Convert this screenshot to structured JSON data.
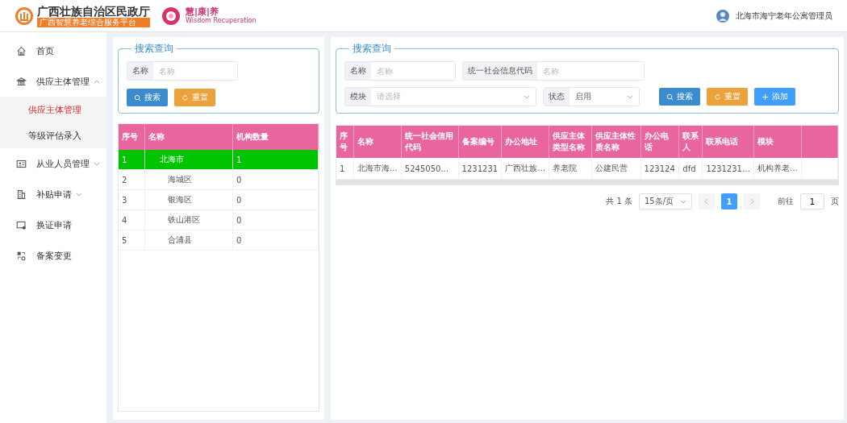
{
  "header": {
    "org_title": "广西壮族自治区民政厅",
    "org_subtitle": "广西智慧养老综合服务平台",
    "brand_title": "慧|康|养",
    "brand_subtitle": "Wisdom Recuperation",
    "user": "北海市海宁老年公寓管理员"
  },
  "sidebar": {
    "items": [
      {
        "label": "首页"
      },
      {
        "label": "供应主体管理",
        "expanded": true,
        "children": [
          {
            "label": "供应主体管理",
            "selected": true
          },
          {
            "label": "等级评估录入",
            "selected": false
          }
        ]
      },
      {
        "label": "从业人员管理",
        "expanded": false
      },
      {
        "label": "补贴申请",
        "expanded": false
      },
      {
        "label": "换证申请"
      },
      {
        "label": "备案变更"
      }
    ]
  },
  "left_panel": {
    "search": {
      "legend": "搜索查询",
      "fields": [
        {
          "label": "名称",
          "placeholder": "名称"
        }
      ],
      "buttons": [
        {
          "kind": "search",
          "label": "搜索"
        },
        {
          "kind": "reset",
          "label": "重置"
        }
      ]
    },
    "table": {
      "columns": [
        "序号",
        "名称",
        "机构数量"
      ],
      "rows": [
        {
          "index": "1",
          "name": "北海市",
          "count": "1",
          "selected": true,
          "expanded": true,
          "children": [
            {
              "index": "2",
              "name": "海城区",
              "count": "0",
              "selected": false
            },
            {
              "index": "3",
              "name": "银海区",
              "count": "0",
              "selected": false
            },
            {
              "index": "4",
              "name": "铁山港区",
              "count": "0",
              "selected": false
            },
            {
              "index": "5",
              "name": "合浦县",
              "count": "0",
              "selected": false
            }
          ]
        }
      ]
    }
  },
  "right_panel": {
    "search": {
      "legend": "搜索查询",
      "fields": [
        {
          "kind": "input",
          "label": "名称",
          "placeholder": "名称"
        },
        {
          "kind": "input",
          "label": "统一社会信息代码",
          "placeholder": "名称"
        },
        {
          "kind": "select",
          "label": "模块",
          "placeholder": "请选择"
        },
        {
          "kind": "select",
          "label": "状态",
          "value": "启用"
        }
      ],
      "buttons": [
        {
          "kind": "search",
          "label": "搜索"
        },
        {
          "kind": "reset",
          "label": "重置"
        },
        {
          "kind": "add",
          "label": "添加"
        }
      ]
    },
    "table": {
      "columns": [
        "序号",
        "名称",
        "统一社会信用代码",
        "备案编号",
        "办公地址",
        "供应主体类型名称",
        "供应主体性质名称",
        "办公电话",
        "联系人",
        "联系电话",
        "模块"
      ],
      "rows": [
        [
          "1",
          "北海市海…",
          "5245050…",
          "1231231",
          "广西壮族…",
          "养老院",
          "公建民营",
          "123124",
          "dfd",
          "1231231…",
          "机构养老…"
        ]
      ]
    },
    "pagination": {
      "total": "共 1 条",
      "page_size": "15条/页",
      "pages": [
        {
          "label": "1",
          "selected": true
        }
      ],
      "goto_label": "前往",
      "goto_value": "1",
      "goto_suffix": "页"
    }
  }
}
